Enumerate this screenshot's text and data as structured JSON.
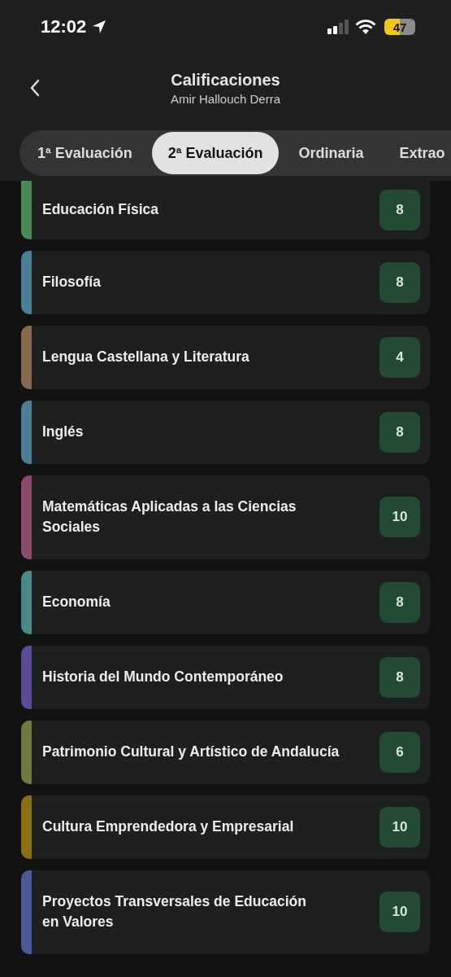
{
  "status_bar": {
    "time": "12:02",
    "battery": "47"
  },
  "header": {
    "title": "Calificaciones",
    "subtitle": "Amir Hallouch Derra"
  },
  "tabs": [
    {
      "label": "1ª Evaluación",
      "selected": false
    },
    {
      "label": "2ª Evaluación",
      "selected": true
    },
    {
      "label": "Ordinaria",
      "selected": false
    },
    {
      "label": "Extrao",
      "selected": false
    }
  ],
  "subjects": [
    {
      "name": "Educación Física",
      "grade": "8",
      "color": "#4a8a55"
    },
    {
      "name": "Filosofía",
      "grade": "8",
      "color": "#4a7f98"
    },
    {
      "name": "Lengua Castellana y Literatura",
      "grade": "4",
      "color": "#8a6a4e"
    },
    {
      "name": "Inglés",
      "grade": "8",
      "color": "#4a7f98"
    },
    {
      "name": "Matemáticas Aplicadas a las Ciencias Sociales",
      "grade": "10",
      "color": "#8e4a6e"
    },
    {
      "name": "Economía",
      "grade": "8",
      "color": "#4a8a86"
    },
    {
      "name": "Historia del Mundo Contemporáneo",
      "grade": "8",
      "color": "#5b4a98"
    },
    {
      "name": "Patrimonio Cultural y Artístico de Andalucía",
      "grade": "6",
      "color": "#6e7a3e"
    },
    {
      "name": "Cultura Emprendedora y Empresarial",
      "grade": "10",
      "color": "#8a7010"
    },
    {
      "name": "Proyectos Transversales de Educación en Valores",
      "grade": "10",
      "color": "#4a5a98"
    }
  ]
}
